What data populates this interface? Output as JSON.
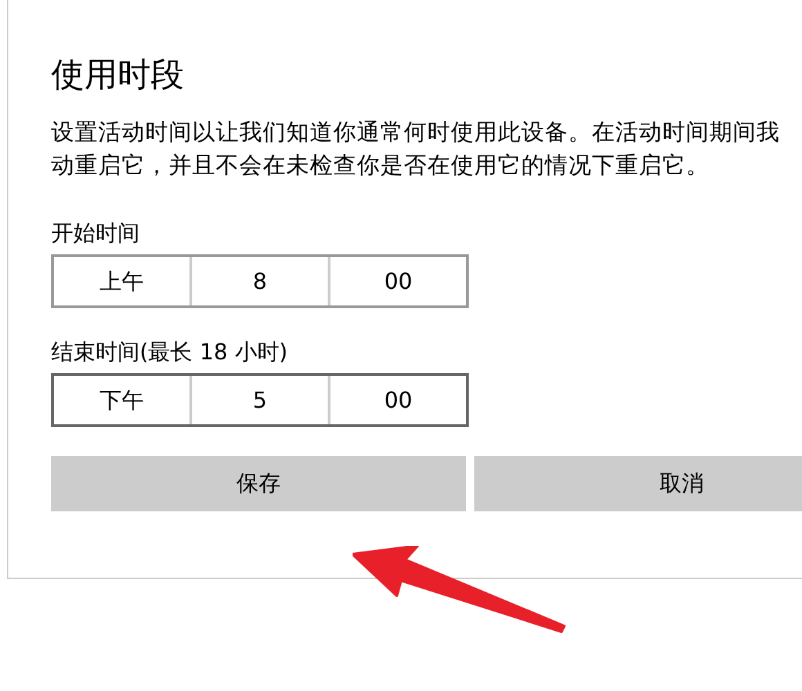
{
  "title": "使用时段",
  "description": [
    "设置活动时间以让我们知道你通常何时使用此设备。在活动时间期间我",
    "动重启它，并且不会在未检查你是否在使用它的情况下重启它。"
  ],
  "pickers": [
    {
      "label": "开始时间",
      "focused": false,
      "parts": [
        "上午",
        "8",
        "00"
      ]
    },
    {
      "label": "结束时间(最长 18 小时)",
      "focused": true,
      "parts": [
        "下午",
        "5",
        "00"
      ]
    }
  ],
  "buttons": [
    "保存",
    "取消"
  ]
}
